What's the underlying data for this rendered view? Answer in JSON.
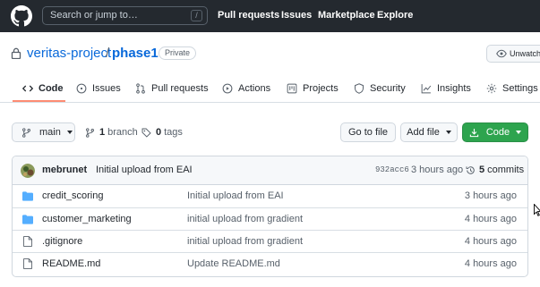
{
  "header": {
    "search_placeholder": "Search or jump to…",
    "search_shortcut": "/",
    "nav": [
      "Pull requests",
      "Issues",
      "Marketplace",
      "Explore"
    ]
  },
  "repo": {
    "owner": "veritas-project",
    "separator": "/",
    "name": "phase1",
    "visibility": "Private",
    "watch_label": "Unwatch"
  },
  "tabs": [
    {
      "label": "Code",
      "icon": "code-icon",
      "active": true
    },
    {
      "label": "Issues",
      "icon": "issue-icon"
    },
    {
      "label": "Pull requests",
      "icon": "pull-request-icon"
    },
    {
      "label": "Actions",
      "icon": "play-icon"
    },
    {
      "label": "Projects",
      "icon": "project-icon"
    },
    {
      "label": "Security",
      "icon": "shield-icon"
    },
    {
      "label": "Insights",
      "icon": "graph-icon"
    },
    {
      "label": "Settings",
      "icon": "gear-icon"
    }
  ],
  "toolbar": {
    "branch": "main",
    "branch_count": "1",
    "branch_label": "branch",
    "tag_count": "0",
    "tag_label": "tags",
    "go_to_file": "Go to file",
    "add_file": "Add file",
    "code": "Code"
  },
  "commit": {
    "author": "mebrunet",
    "message": "Initial upload from EAI",
    "sha": "932acc6",
    "time": "3 hours ago",
    "count": "5",
    "count_label": "commits"
  },
  "files": [
    {
      "type": "folder",
      "name": "credit_scoring",
      "message": "Initial upload from EAI",
      "time": "3 hours ago"
    },
    {
      "type": "folder",
      "name": "customer_marketing",
      "message": "initial upload from gradient",
      "time": "4 hours ago"
    },
    {
      "type": "file",
      "name": ".gitignore",
      "message": "initial upload from gradient",
      "time": "4 hours ago"
    },
    {
      "type": "file",
      "name": "README.md",
      "message": "Update README.md",
      "time": "4 hours ago"
    }
  ],
  "colors": {
    "header_bg": "#24292f",
    "link": "#0969da",
    "tab_underline": "#fd8c73",
    "code_button": "#2da44e",
    "folder_icon": "#54aeff"
  }
}
